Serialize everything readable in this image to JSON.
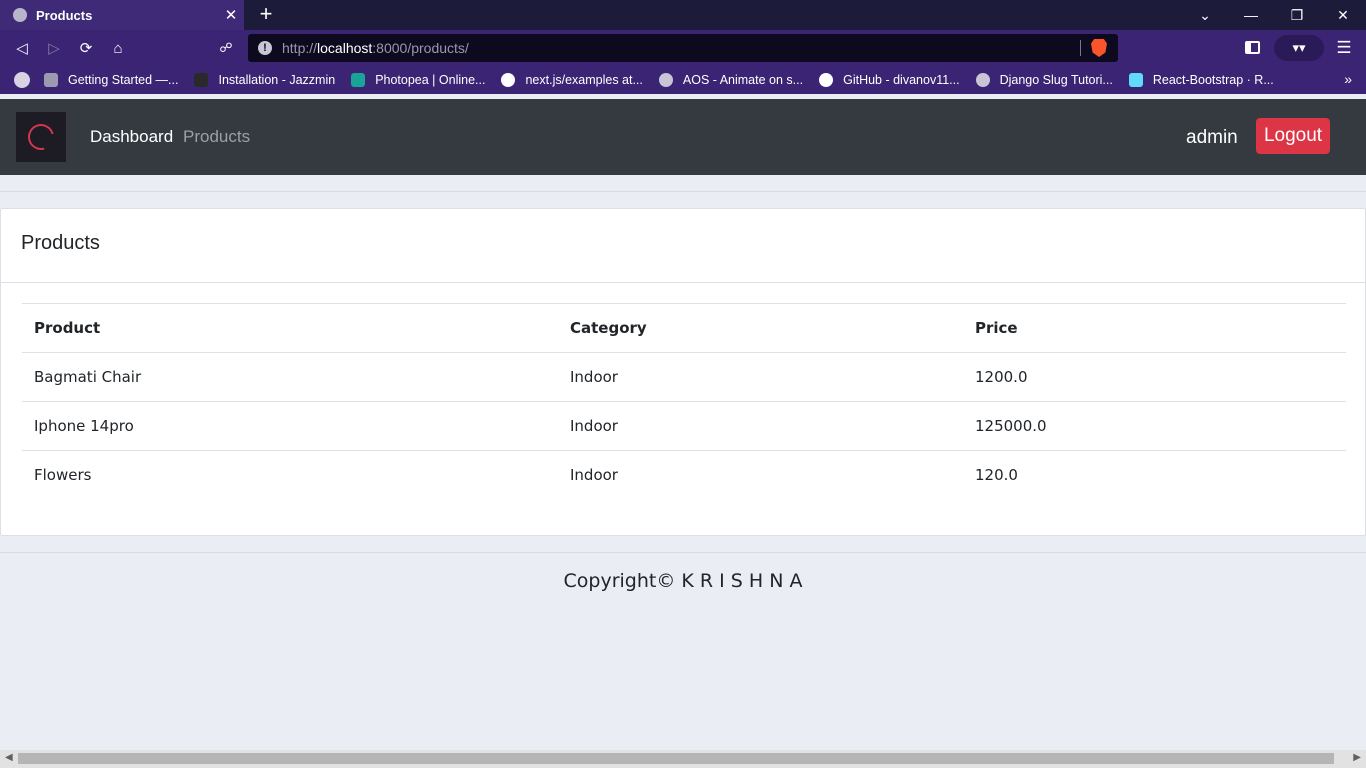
{
  "browser": {
    "tab_title": "Products",
    "tab_close": "✕",
    "new_tab": "+",
    "url_scheme_prefix": "http://",
    "url_host": "localhost",
    "url_rest": ":8000/products/",
    "window_controls": {
      "dropdown": "⌄",
      "minimize": "—",
      "restore": "❐",
      "close": "✕"
    },
    "nav": {
      "back": "◁",
      "forward": "▷",
      "reload": "⟳",
      "home": "⌂",
      "bookmark": "🔖"
    },
    "ext_glyph": "▾▾",
    "menu_glyph": "☰",
    "bookmarks": [
      {
        "label": "Getting Started —...",
        "icon": "bookmark-icon",
        "color": "#9c9ab0"
      },
      {
        "label": "Installation - Jazzmin",
        "icon": "book-icon",
        "color": "#2a2a2a"
      },
      {
        "label": "Photopea | Online...",
        "icon": "photopea-icon",
        "color": "#18a497"
      },
      {
        "label": "next.js/examples at...",
        "icon": "github-icon",
        "color": "#ffffff"
      },
      {
        "label": "AOS - Animate on s...",
        "icon": "globe-icon",
        "color": "#c9c5d6"
      },
      {
        "label": "GitHub - divanov11...",
        "icon": "github-icon",
        "color": "#ffffff"
      },
      {
        "label": "Django Slug Tutori...",
        "icon": "globe-icon",
        "color": "#c9c5d6"
      },
      {
        "label": "React-Bootstrap · R...",
        "icon": "react-bootstrap-icon",
        "color": "#61dafb"
      }
    ],
    "bookmarks_more": "»"
  },
  "nav": {
    "links": [
      "Dashboard",
      "Products"
    ],
    "user": "admin",
    "logout": "Logout"
  },
  "page": {
    "card_title": "Products",
    "table": {
      "headers": [
        "Product",
        "Category",
        "Price"
      ],
      "rows": [
        [
          "Bagmati Chair",
          "Indoor",
          "1200.0"
        ],
        [
          "Iphone 14pro",
          "Indoor",
          "125000.0"
        ],
        [
          "Flowers",
          "Indoor",
          "120.0"
        ]
      ]
    },
    "footer": "Copyright© K R I S H N A"
  }
}
